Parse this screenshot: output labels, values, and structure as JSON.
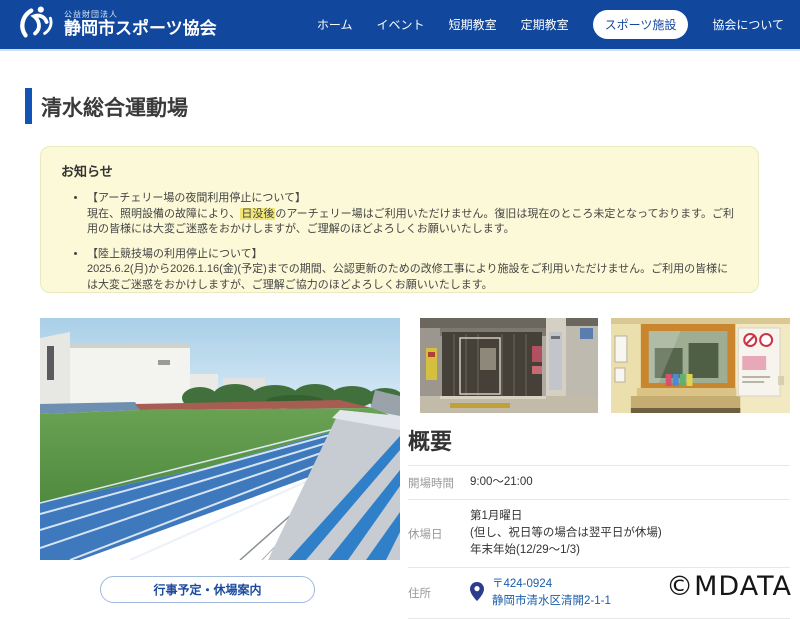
{
  "header": {
    "org_type": "公益財団法人",
    "org_name": "静岡市スポーツ協会",
    "nav": [
      {
        "label": "ホーム",
        "active": false
      },
      {
        "label": "イベント",
        "active": false
      },
      {
        "label": "短期教室",
        "active": false
      },
      {
        "label": "定期教室",
        "active": false
      },
      {
        "label": "スポーツ施設",
        "active": true
      },
      {
        "label": "協会について",
        "active": false
      }
    ]
  },
  "page": {
    "title": "清水総合運動場"
  },
  "notice": {
    "title": "お知らせ",
    "items": [
      {
        "heading": "【アーチェリー場の夜間利用停止について】",
        "body_pre": "現在、照明設備の故障により、",
        "body_highlight": "日没後",
        "body_post": "のアーチェリー場はご利用いただけません。復旧は現在のところ未定となっております。ご利用の皆様には大変ご迷惑をおかけしますが、ご理解のほどよろしくお願いいたします。"
      },
      {
        "heading": "【陸上競技場の利用停止について】",
        "body": "2025.6.2(月)から2026.1.16(金)(予定)までの期間、公認更新のための改修工事により施設をご利用いただけません。ご利用の皆様には大変ご迷惑をおかけしますが、ご理解ご協力のほどよろしくお願いいたします。"
      }
    ]
  },
  "photos": {
    "main": "athletics-track-and-stands",
    "small_1": "facility-entrance",
    "small_2": "reception-counter"
  },
  "overview": {
    "title": "概要",
    "rows": {
      "hours": {
        "label": "開場時間",
        "value": "9:00～21:00"
      },
      "closed": {
        "label": "休場日",
        "line1": "第1月曜日",
        "line2": "(但し、祝日等の場合は翌平日が休場)",
        "line3": "年末年始(12/29～1/3)"
      },
      "address": {
        "label": "住所",
        "postal": "〒424-0924",
        "value": "静岡市清水区清開2-1-1"
      }
    }
  },
  "actions": {
    "schedule_button": "行事予定・休場案内"
  },
  "watermark": "©MDATA",
  "colors": {
    "header_blue": "#11489d",
    "title_bar_blue": "#1353b4",
    "link_blue": "#1a5dab",
    "notice_bg": "#fbf9d7",
    "highlight_yellow": "#f3e678"
  }
}
